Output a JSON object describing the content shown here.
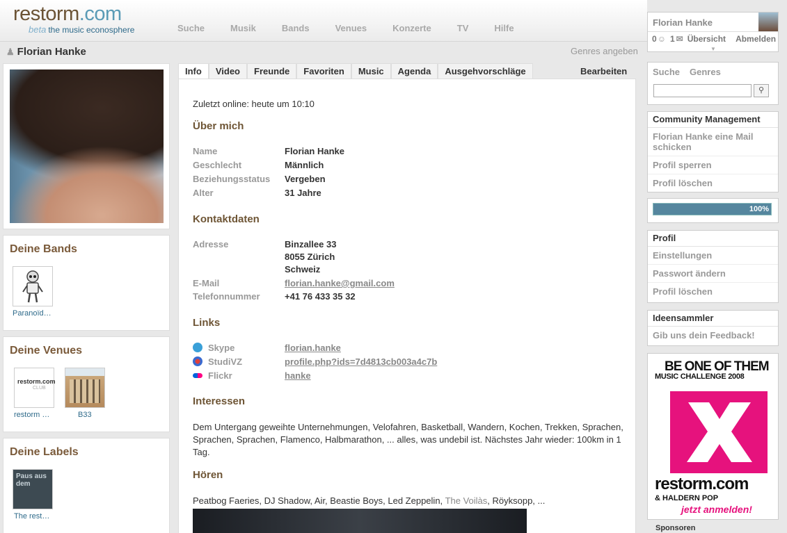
{
  "header": {
    "logo_name": "restorm",
    "logo_tld": ".com",
    "logo_beta": "beta",
    "logo_tagline": "the music econosphere",
    "nav": [
      "Suche",
      "Musik",
      "Bands",
      "Venues",
      "Konzerte",
      "TV",
      "Hilfe"
    ]
  },
  "userbox": {
    "name": "Florian Hanke",
    "friends_count": "0",
    "mail_count": "1",
    "overview": "Übersicht",
    "logout": "Abmelden"
  },
  "page": {
    "title": "Florian Hanke",
    "genres_link": "Genres angeben"
  },
  "left": {
    "bands_title": "Deine Bands",
    "bands": [
      "Paranoïd…"
    ],
    "venues_title": "Deine Venues",
    "venues": [
      "restorm …",
      "B33"
    ],
    "labels_title": "Deine Labels",
    "labels": [
      "The rest…"
    ],
    "venue_logo_text": "restorm.com",
    "venue_logo_sub": "CLUB",
    "label_thumb_text": "Paus aus dem"
  },
  "tabs": [
    "Info",
    "Video",
    "Freunde",
    "Favoriten",
    "Music",
    "Agenda",
    "Ausgehvorschläge"
  ],
  "edit_label": "Bearbeiten",
  "profile": {
    "last_online": "Zuletzt online: heute um 10:10",
    "about_title": "Über mich",
    "about": [
      {
        "label": "Name",
        "value": "Florian Hanke"
      },
      {
        "label": "Geschlecht",
        "value": "Männlich"
      },
      {
        "label": "Beziehungsstatus",
        "value": "Vergeben"
      },
      {
        "label": "Alter",
        "value": "31 Jahre"
      }
    ],
    "contact_title": "Kontaktdaten",
    "address_label": "Adresse",
    "address_lines": [
      "Binzallee 33",
      "8055 Zürich",
      "Schweiz"
    ],
    "email_label": "E-Mail",
    "email": "florian.hanke@gmail.com",
    "phone_label": "Telefonnummer",
    "phone": "+41 76 433 35 32",
    "links_title": "Links",
    "links": [
      {
        "label": "Skype",
        "value": "florian.hanke",
        "icon": "skype-icon",
        "color": "#3aa0d8"
      },
      {
        "label": "StudiVZ",
        "value": "profile.php?ids=7d4813cb003a4c7b",
        "icon": "studivz-icon",
        "color": "#e0403a"
      },
      {
        "label": "Flickr",
        "value": "hanke",
        "icon": "flickr-icon",
        "color": "#ff0084"
      }
    ],
    "interests_title": "Interessen",
    "interests": "Dem Untergang geweihte Unternehmungen, Velofahren, Basketball, Wandern, Kochen, Trekken, Sprachen, Sprachen, Sprachen, Flamenco, Halbmarathon, ... alles, was undebil ist. Nächstes Jahr wieder: 100km in 1 Tag.",
    "listening_title": "Hören",
    "listening_before": "Peatbog Faeries, DJ Shadow, Air, Beastie Boys, Led Zeppelin,",
    "listening_link": "The Voilàs",
    "listening_after": ", Röyksopp, ..."
  },
  "right": {
    "search_tabs": [
      "Suche",
      "Genres"
    ],
    "community_title": "Community Management",
    "community_items": [
      "Florian Hanke eine Mail schicken",
      "Profil sperren",
      "Profil löschen"
    ],
    "progress_label": "100%",
    "progress_value": 1.0,
    "profile_title": "Profil",
    "profile_items": [
      "Einstellungen",
      "Passwort ändern",
      "Profil löschen"
    ],
    "ideas_title": "Ideensammler",
    "ideas_item": "Gib uns dein Feedback!",
    "ad_line1": "BE ONE OF THEM",
    "ad_line2": "MUSIC CHALLENGE 2008",
    "ad_brand": "restorm.com",
    "ad_partner": "& HALDERN POP",
    "ad_cta": "jetzt anmelden!",
    "sponsors": "Sponsoren"
  },
  "colors": {
    "brand_brown": "#6e5535",
    "accent_blue": "#2e6a8a",
    "ad_pink": "#e6127d"
  }
}
